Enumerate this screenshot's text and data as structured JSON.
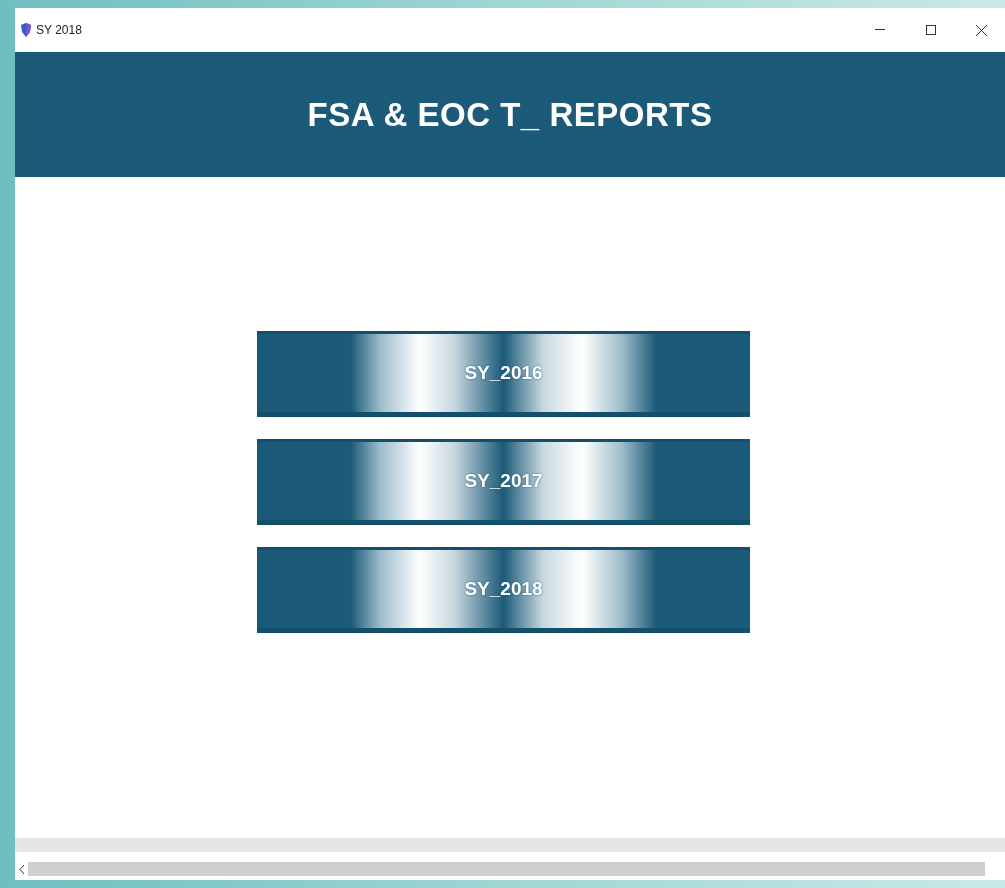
{
  "window": {
    "title": "SY 2018"
  },
  "header": {
    "title": "FSA & EOC T_ REPORTS"
  },
  "buttons": [
    {
      "label": "SY_2016"
    },
    {
      "label": "SY_2017"
    },
    {
      "label": "SY_2018"
    }
  ]
}
